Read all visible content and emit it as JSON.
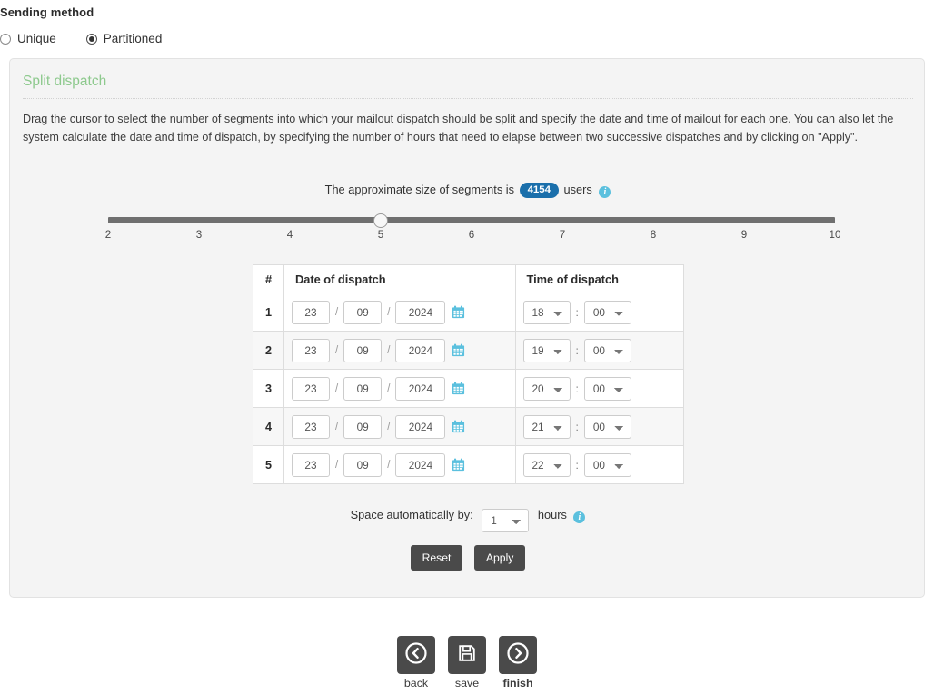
{
  "sending_method": {
    "title": "Sending method",
    "options": [
      {
        "label": "Unique",
        "selected": false
      },
      {
        "label": "Partitioned",
        "selected": true
      }
    ]
  },
  "panel": {
    "heading": "Split dispatch",
    "description": "Drag the cursor to select the number of segments into which your mailout dispatch should be split and specify the date and time of mailout for each one. You can also let the system calculate the date and time of dispatch, by specifying the number of hours that need to elapse between two successive dispatches and by clicking on \"Apply\".",
    "segment_info": {
      "prefix": "The approximate size of segments is",
      "count": "4154",
      "suffix": "users",
      "info_icon": "info-icon",
      "badge_color": "#1a6fab",
      "info_color": "#5bc0de"
    },
    "slider": {
      "min": 2,
      "max": 10,
      "value": 5,
      "ticks": [
        "2",
        "3",
        "4",
        "5",
        "6",
        "7",
        "8",
        "9",
        "10"
      ]
    },
    "table": {
      "headers": [
        "#",
        "Date of dispatch",
        "Time of dispatch"
      ],
      "rows": [
        {
          "num": "1",
          "day": "23",
          "month": "09",
          "year": "2024",
          "hour": "18",
          "minute": "00"
        },
        {
          "num": "2",
          "day": "23",
          "month": "09",
          "year": "2024",
          "hour": "19",
          "minute": "00"
        },
        {
          "num": "3",
          "day": "23",
          "month": "09",
          "year": "2024",
          "hour": "20",
          "minute": "00"
        },
        {
          "num": "4",
          "day": "23",
          "month": "09",
          "year": "2024",
          "hour": "21",
          "minute": "00"
        },
        {
          "num": "5",
          "day": "23",
          "month": "09",
          "year": "2024",
          "hour": "22",
          "minute": "00"
        }
      ],
      "separator": "/",
      "time_separator": ":",
      "calendar_icon": "calendar-icon"
    },
    "spacing": {
      "label": "Space automatically by:",
      "value": "1",
      "unit": "hours",
      "info_icon": "info-icon"
    },
    "actions": {
      "reset": "Reset",
      "apply": "Apply"
    }
  },
  "wizard_nav": {
    "back": {
      "label": "back",
      "icon": "chevron-left-circle-icon"
    },
    "save": {
      "label": "save",
      "icon": "floppy-disk-icon"
    },
    "finish": {
      "label": "finish",
      "icon": "chevron-right-circle-icon"
    }
  }
}
